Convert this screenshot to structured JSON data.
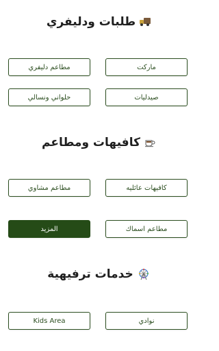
{
  "sections": {
    "delivery": {
      "title": "طلبات ودليفري",
      "icon": "delivery-truck-icon",
      "buttons": {
        "market": "ماركت",
        "restaurants_delivery": "مطاعم دليفري",
        "pharmacies": "صيدليات",
        "sweets_and_nuts": "حلواني ونسالي"
      }
    },
    "cafes": {
      "title": "كافيهات ومطاعم",
      "icon": "coffee-cup-icon",
      "buttons": {
        "family_cafes": "كافيهات عائليه",
        "grill_restaurants": "مطاعم مشاوي",
        "fish_restaurants": "مطاعم اسماك",
        "more": "المزيد"
      }
    },
    "entertainment": {
      "title": "خدمات ترفيهية",
      "icon": "ferris-wheel-icon",
      "buttons": {
        "clubs": "نوادي",
        "kids_area": "Kids Area"
      }
    }
  },
  "colors": {
    "accent": "#254b17",
    "border": "#2b4d1f",
    "background": "#ffffff"
  }
}
